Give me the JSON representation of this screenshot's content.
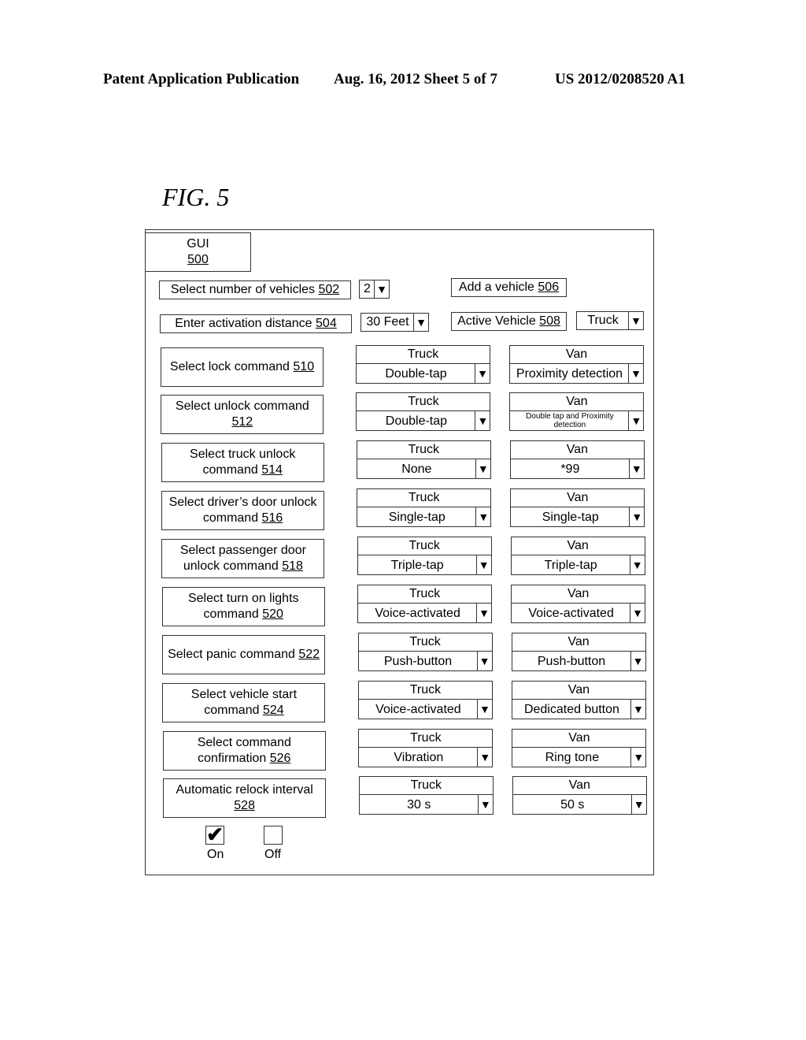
{
  "header": {
    "publication": "Patent Application Publication",
    "date_sheet": "Aug. 16, 2012  Sheet 5 of 7",
    "number": "US 2012/0208520 A1"
  },
  "figure_label": "FIG. 5",
  "gui": {
    "title": "GUI",
    "ref": "500"
  },
  "top_controls": {
    "num_vehicles": {
      "label": "Select number of vehicles ",
      "ref": "502",
      "value": "2"
    },
    "add_vehicle": {
      "label": "Add a vehicle ",
      "ref": "506"
    },
    "activation_distance": {
      "label": "Enter activation distance ",
      "ref": "504",
      "value": "30 Feet"
    },
    "active_vehicle": {
      "label": "Active Vehicle ",
      "ref": "508",
      "value": "Truck"
    }
  },
  "arrow_glyph": "▼",
  "commands": [
    {
      "line1": "Select lock command ",
      "line2": "",
      "ref": "510",
      "truck_label": "Truck",
      "truck_value": "Double-tap",
      "van_label": "Van",
      "van_value": "Proximity detection"
    },
    {
      "line1": "Select unlock command",
      "line2": "",
      "ref": "512",
      "truck_label": "Truck",
      "truck_value": "Double-tap",
      "van_label": "Van",
      "van_value": "Double tap and Proximity detection"
    },
    {
      "line1": "Select truck unlock",
      "line2": "command ",
      "ref": "514",
      "truck_label": "Truck",
      "truck_value": "None",
      "van_label": "Van",
      "van_value": "*99"
    },
    {
      "line1": "Select driver’s door unlock",
      "line2": "command ",
      "ref": "516",
      "truck_label": "Truck",
      "truck_value": "Single-tap",
      "van_label": "Van",
      "van_value": "Single-tap"
    },
    {
      "line1": "Select passenger door",
      "line2": "unlock command ",
      "ref": "518",
      "truck_label": "Truck",
      "truck_value": "Triple-tap",
      "van_label": "Van",
      "van_value": "Triple-tap"
    },
    {
      "line1": "Select turn on lights",
      "line2": "command ",
      "ref": "520",
      "truck_label": "Truck",
      "truck_value": "Voice-activated",
      "van_label": "Van",
      "van_value": "Voice-activated"
    },
    {
      "line1": "Select panic command ",
      "line2": "",
      "ref": "522",
      "truck_label": "Truck",
      "truck_value": "Push-button",
      "van_label": "Van",
      "van_value": "Push-button"
    },
    {
      "line1": "Select vehicle start",
      "line2": "command ",
      "ref": "524",
      "truck_label": "Truck",
      "truck_value": "Voice-activated",
      "van_label": "Van",
      "van_value": "Dedicated button"
    },
    {
      "line1": "Select command",
      "line2": "confirmation ",
      "ref": "526",
      "truck_label": "Truck",
      "truck_value": "Vibration",
      "van_label": "Van",
      "van_value": "Ring tone"
    },
    {
      "line1": "Automatic relock interval",
      "line2": "",
      "ref": "528",
      "truck_label": "Truck",
      "truck_value": "30 s",
      "van_label": "Van",
      "van_value": "50 s"
    }
  ],
  "toggle": {
    "on": {
      "label": "On",
      "checked": true,
      "mark": "✔"
    },
    "off": {
      "label": "Off",
      "checked": false
    }
  }
}
